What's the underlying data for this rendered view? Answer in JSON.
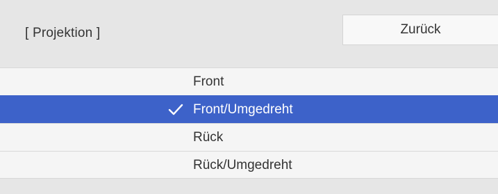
{
  "header": {
    "title": "[ Projektion ]",
    "back_label": "Zurück"
  },
  "options": [
    {
      "label": "Front",
      "selected": false
    },
    {
      "label": "Front/Umgedreht",
      "selected": true
    },
    {
      "label": "Rück",
      "selected": false
    },
    {
      "label": "Rück/Umgedreht",
      "selected": false
    }
  ],
  "icons": {
    "selected_marker": "check-icon"
  },
  "colors": {
    "selected_background": "#3d62c9",
    "panel_background": "#e6e6e6",
    "row_background": "#f5f5f5"
  }
}
